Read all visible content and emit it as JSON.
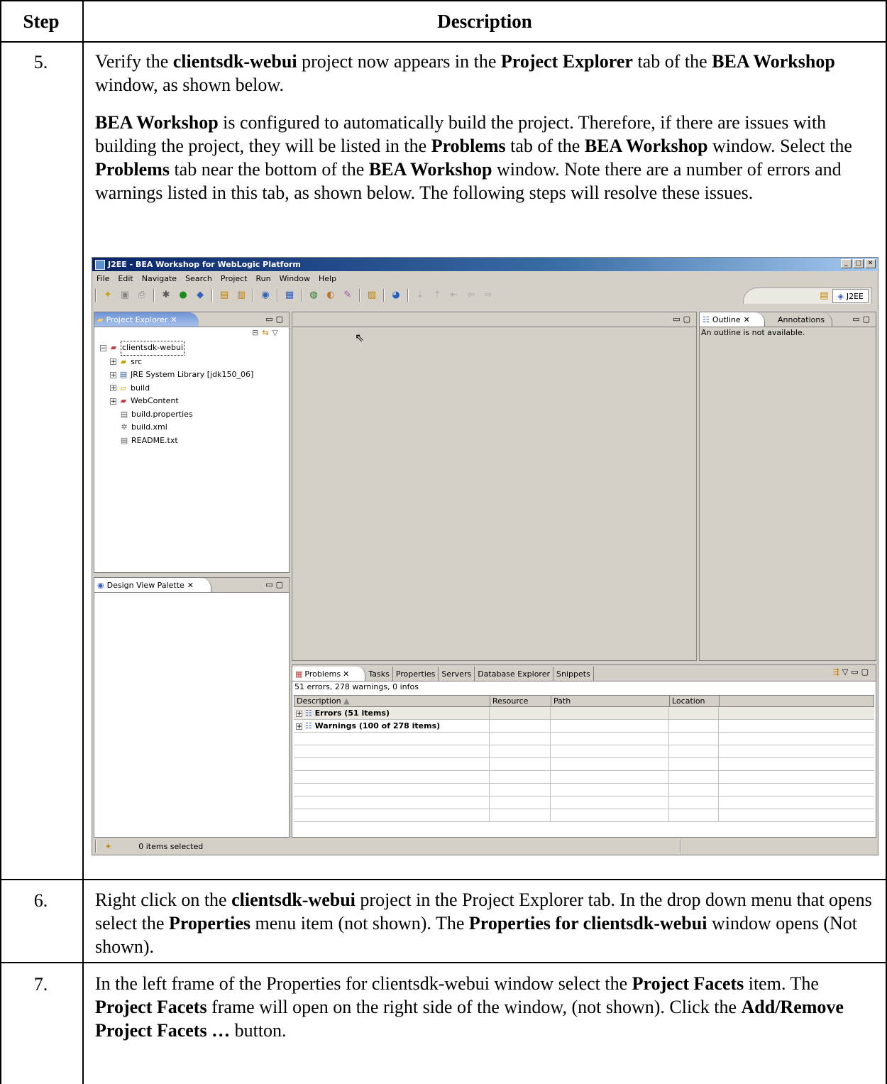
{
  "header": {
    "step": "Step",
    "description": "Description"
  },
  "steps": [
    {
      "number": "5.",
      "para1": [
        "Verify the ",
        "clientsdk-webui",
        " project now appears in the ",
        "Project Explorer",
        " tab of the ",
        "BEA Workshop",
        " window, as shown below."
      ],
      "para2": [
        "BEA Workshop",
        " is configured to automatically build the project. Therefore, if there are issues with building the project, they will be listed in the ",
        "Problems",
        " tab of the ",
        "BEA Workshop",
        " window. Select the ",
        "Problems",
        " tab near the bottom of the ",
        "BEA Workshop",
        " window. Note there are a number of errors and warnings listed in this tab, as shown below. The following steps will resolve these issues."
      ]
    },
    {
      "number": "6.",
      "para1": [
        "Right click on the ",
        "clientsdk-webui",
        " project in the Project Explorer tab. In the drop down menu that opens select the ",
        "Properties",
        " menu item (not shown). The ",
        "Properties for clientsdk-webui",
        " window opens (Not shown)."
      ]
    },
    {
      "number": "7.",
      "para1": [
        "In the left frame of the Properties for clientsdk-webui window select the ",
        "Project Facets",
        " item. The ",
        "Project Facets",
        " frame will open on the right side of the window, (not shown). Click the ",
        "Add/Remove Project Facets …",
        " button."
      ]
    }
  ],
  "screenshot": {
    "window_title": "J2EE - BEA Workshop for WebLogic Platform",
    "menu": [
      "File",
      "Edit",
      "Navigate",
      "Search",
      "Project",
      "Run",
      "Window",
      "Help"
    ],
    "perspective": "J2EE",
    "project_explorer": {
      "tab": "Project Explorer",
      "root": "clientsdk-webui",
      "children": [
        "src",
        "JRE System Library [jdk150_06]",
        "build",
        "WebContent",
        "build.properties",
        "build.xml",
        "README.txt"
      ]
    },
    "palette_tab": "Design View Palette",
    "outline": {
      "tab": "Outline",
      "tab2": "Annotations",
      "message": "An outline is not available."
    },
    "problems": {
      "tabs": [
        "Problems",
        "Tasks",
        "Properties",
        "Servers",
        "Database Explorer",
        "Snippets"
      ],
      "summary": "51 errors, 278 warnings, 0 infos",
      "columns": [
        "Description",
        "Resource",
        "Path",
        "Location"
      ],
      "rows": [
        "Errors (51 items)",
        "Warnings (100 of 278 items)"
      ]
    },
    "status": "0 items selected"
  }
}
